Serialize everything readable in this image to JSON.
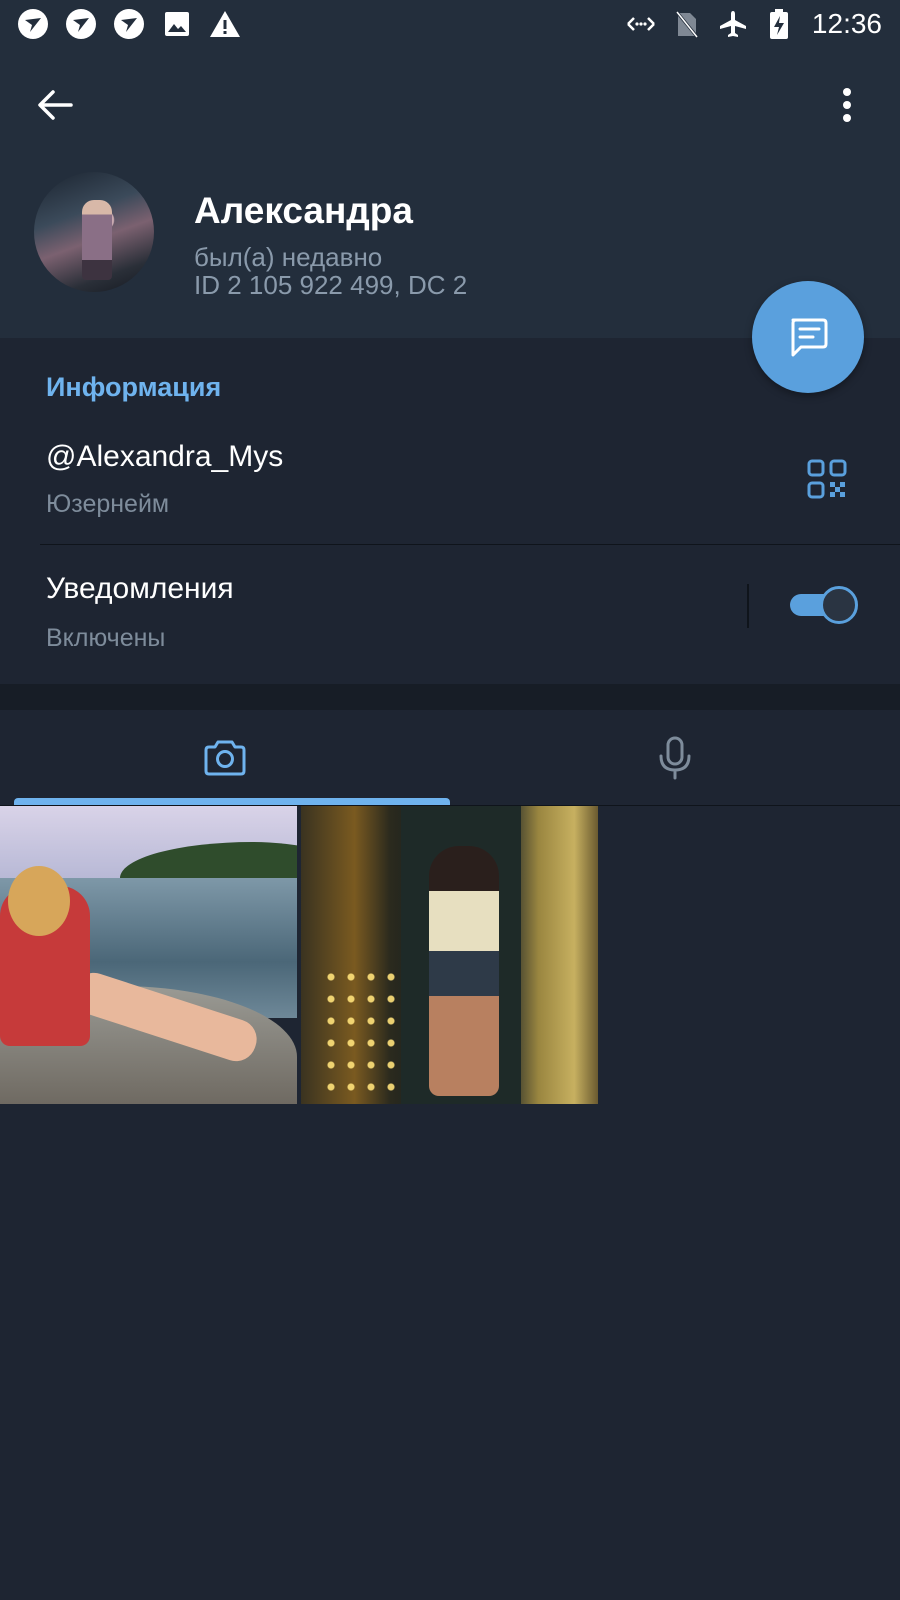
{
  "status_bar": {
    "time": "12:36",
    "left_icons": [
      "app-notification-icon",
      "app-notification-icon",
      "app-notification-icon",
      "image-icon",
      "warning-icon"
    ],
    "right_icons": [
      "data-sync-icon",
      "no-sim-icon",
      "airplane-mode-icon",
      "battery-charging-icon"
    ]
  },
  "header": {
    "back_icon": "arrow-left-icon",
    "menu_icon": "more-vertical-icon",
    "name": "Александра",
    "last_seen": "был(а) недавно",
    "id_line": "ID 2 105 922 499, DC 2"
  },
  "fab": {
    "icon": "message-icon"
  },
  "info": {
    "title": "Информация",
    "username_value": "@Alexandra_Mys",
    "username_label": "Юзернейм",
    "qr_icon": "qr-code-icon",
    "notifications_title": "Уведомления",
    "notifications_status": "Включены",
    "notifications_enabled": true
  },
  "media_tabs": [
    {
      "icon": "camera-icon",
      "active": true
    },
    {
      "icon": "microphone-icon",
      "active": false
    }
  ],
  "media_items": [
    {
      "kind": "photo"
    },
    {
      "kind": "photo"
    }
  ],
  "colors": {
    "background": "#1e2532",
    "header_bg": "#232e3c",
    "accent": "#6fb3ee",
    "fab": "#5aa0dd",
    "secondary_text": "#8a9aab"
  }
}
